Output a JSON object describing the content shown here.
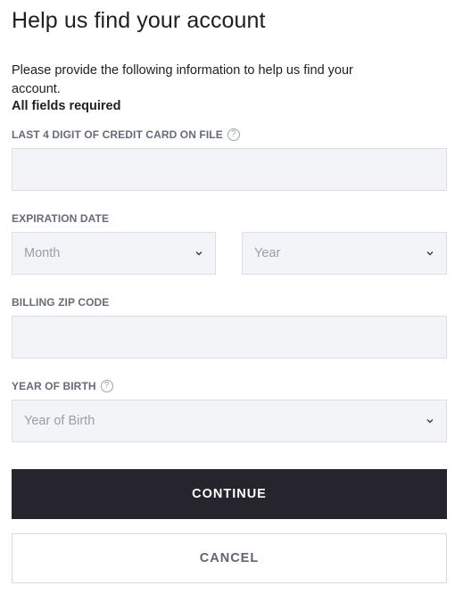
{
  "heading": "Help us find your account",
  "intro": "Please provide the following information to help us find your account.",
  "required_note": "All fields required",
  "fields": {
    "card_last4": {
      "label": "LAST 4 DIGIT OF CREDIT CARD ON FILE",
      "help_icon": "question-mark",
      "value": ""
    },
    "expiration": {
      "label": "EXPIRATION DATE",
      "month_placeholder": "Month",
      "year_placeholder": "Year",
      "chevron_icon": "chevron-down"
    },
    "zip": {
      "label": "BILLING ZIP CODE",
      "value": ""
    },
    "birth_year": {
      "label": "YEAR OF BIRTH",
      "help_icon": "question-mark",
      "placeholder": "Year of Birth",
      "chevron_icon": "chevron-down"
    }
  },
  "help_glyph": "?",
  "buttons": {
    "continue": "CONTINUE",
    "cancel": "CANCEL"
  },
  "colors": {
    "primary_button": "#26252d",
    "field_bg": "#f3f4f8",
    "label": "#676b7a",
    "placeholder": "#9a9dab"
  }
}
